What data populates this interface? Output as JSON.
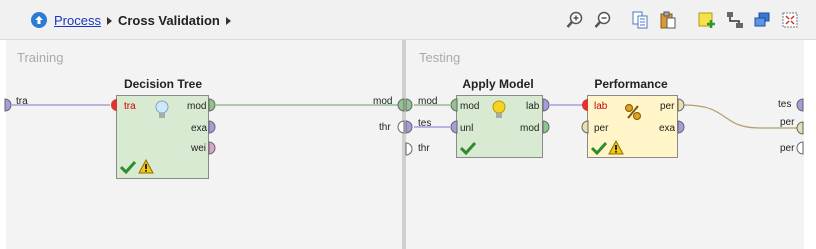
{
  "breadcrumb": {
    "root": "Process",
    "current": "Cross Validation"
  },
  "toolbar": {
    "icons": [
      "zoom-in-icon",
      "zoom-out-icon",
      "copy-icon",
      "paste-icon",
      "add-note-icon",
      "auto-wire-icon",
      "arrange-icon",
      "fit-icon"
    ]
  },
  "panels": {
    "training": "Training",
    "testing": "Testing"
  },
  "ports": {
    "training_in": "tra",
    "training_out_mod": "mod",
    "training_out_thr": "thr",
    "testing_in_mod": "mod",
    "testing_in_tes": "tes",
    "testing_in_thr": "thr",
    "testing_out_tes": "tes",
    "testing_out_per1": "per",
    "testing_out_per2": "per"
  },
  "operators": {
    "decision_tree": {
      "title": "Decision Tree",
      "in": [
        "tra"
      ],
      "out": [
        "mod",
        "exa",
        "wei"
      ]
    },
    "apply_model": {
      "title": "Apply Model",
      "in": [
        "mod",
        "unl"
      ],
      "out": [
        "lab",
        "mod"
      ]
    },
    "performance": {
      "title": "Performance",
      "in": [
        "lab",
        "per"
      ],
      "out": [
        "per",
        "exa"
      ]
    }
  },
  "colors": {
    "operator_green": "#d9ead3",
    "operator_yellow": "#fff5c8",
    "wire_purple": "#9a8ad6",
    "wire_green": "#7bb87b",
    "wire_olive": "#b3a16a"
  }
}
